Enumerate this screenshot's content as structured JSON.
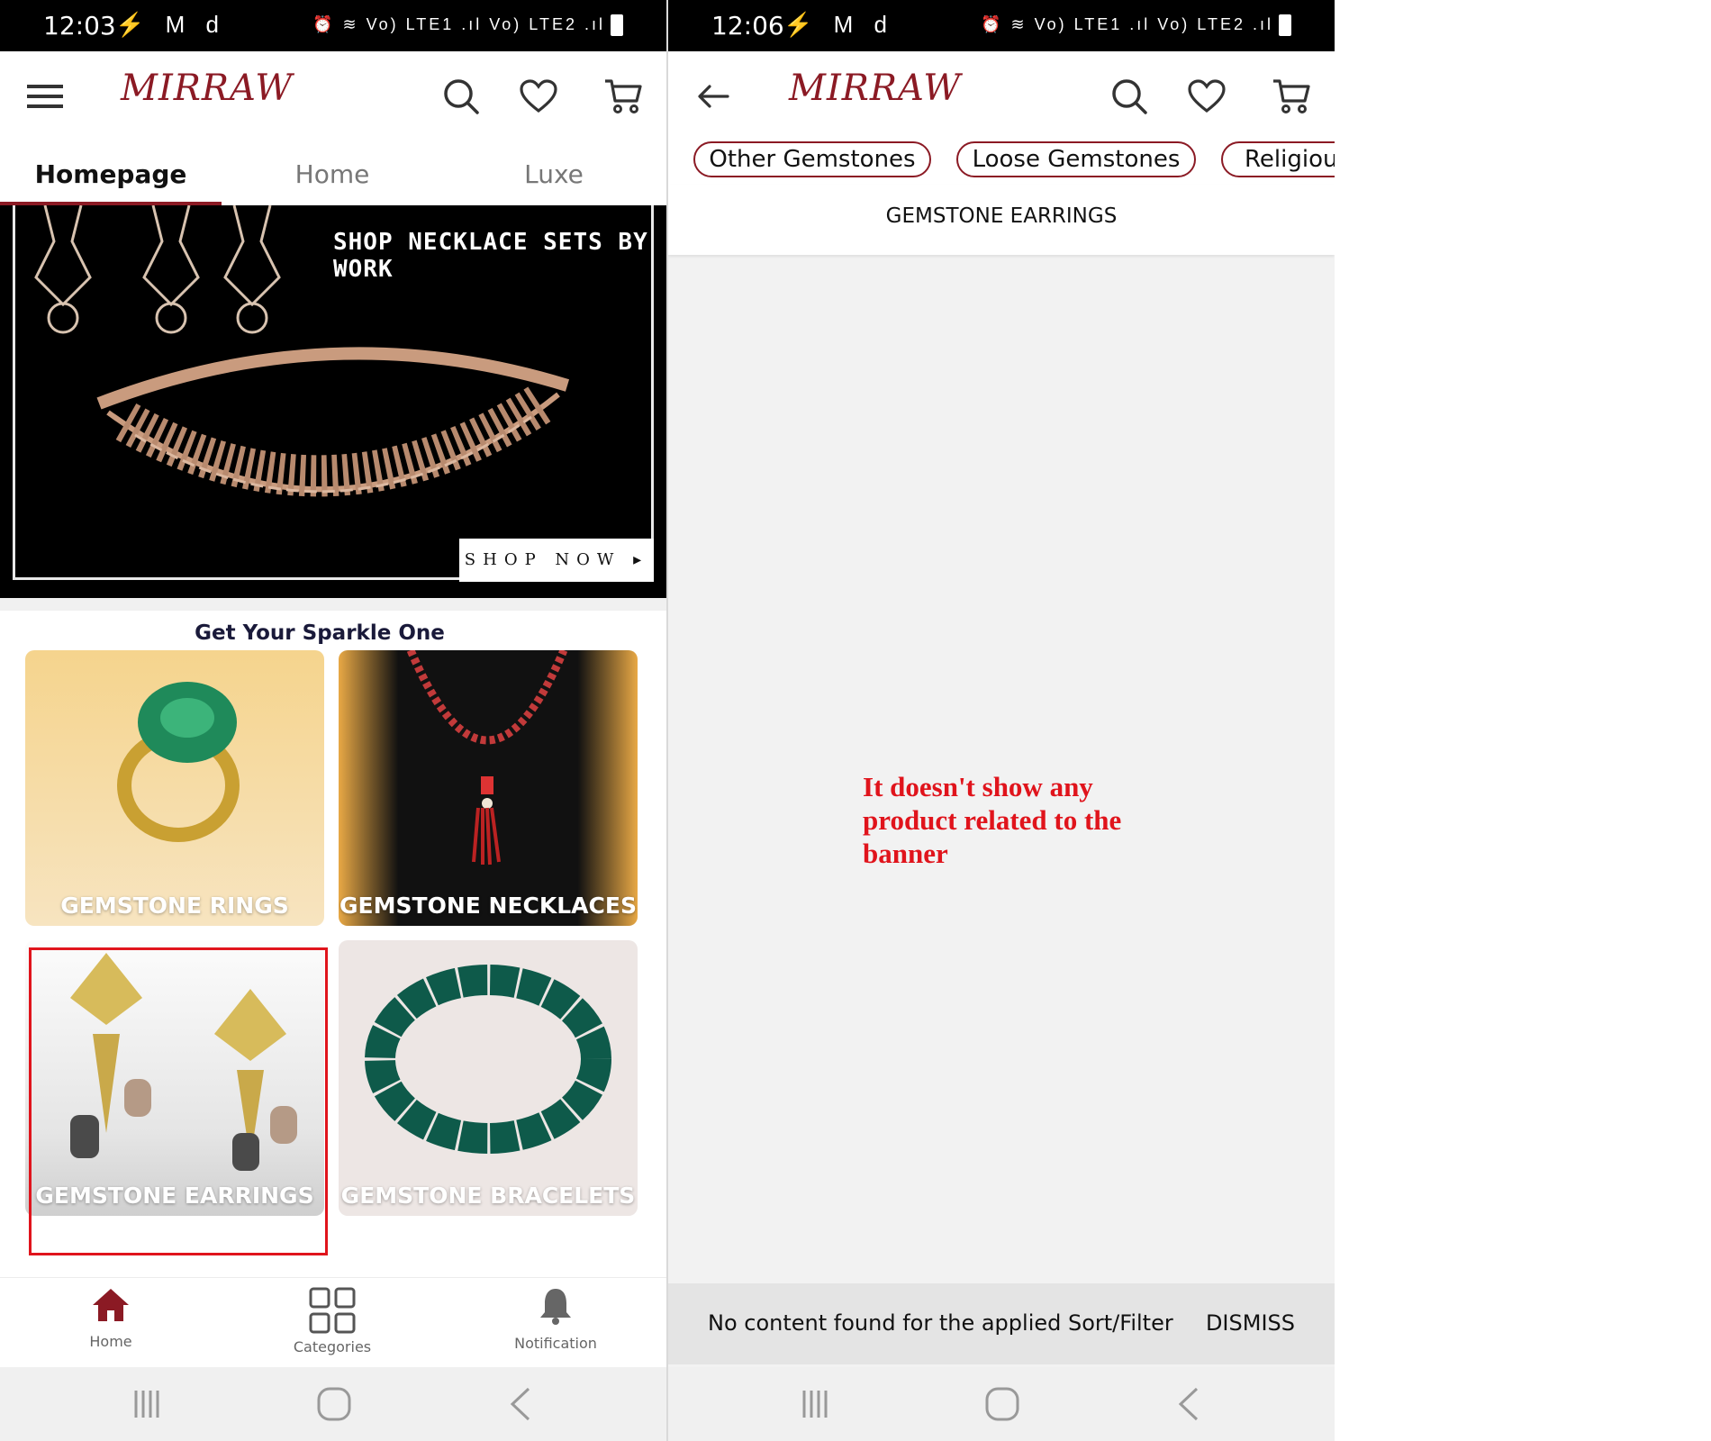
{
  "left_screen": {
    "status_bar": {
      "time": "12:03",
      "left_icons": "⚡ M d",
      "right_icons": "⏰ ≋ Vo) LTE1 .ıl Vo) LTE2 .ıl"
    },
    "app_bar": {
      "logo": "MIRRAW",
      "icons": [
        "menu-icon",
        "search-icon",
        "heart-icon",
        "cart-icon"
      ]
    },
    "tabs": [
      {
        "label": "Homepage",
        "active": true
      },
      {
        "label": "Home",
        "active": false
      },
      {
        "label": "Luxe",
        "active": false
      }
    ],
    "banner": {
      "headline": "SHOP NECKLACE SETS BY WORK",
      "cta": "SHOP NOW ▸"
    },
    "section": {
      "title": "Get Your Sparkle One",
      "tiles": [
        {
          "label": "GEMSTONE RINGS"
        },
        {
          "label": "GEMSTONE NECKLACES"
        },
        {
          "label": "GEMSTONE EARRINGS",
          "highlighted": true
        },
        {
          "label": "GEMSTONE BRACELETS"
        }
      ]
    },
    "bottom_nav": [
      {
        "label": "Home",
        "icon": "home-icon",
        "active": true
      },
      {
        "label": "Categories",
        "icon": "grid-icon",
        "active": false
      },
      {
        "label": "Notification",
        "icon": "bell-icon",
        "active": false
      }
    ]
  },
  "right_screen": {
    "status_bar": {
      "time": "12:06",
      "left_icons": "⚡ M d",
      "right_icons": "⏰ ≋ Vo) LTE1 .ıl Vo) LTE2 .ıl"
    },
    "app_bar": {
      "logo": "MIRRAW",
      "icons": [
        "back-arrow-icon",
        "search-icon",
        "heart-icon",
        "cart-icon"
      ]
    },
    "chips": [
      "Other Gemstones",
      "Loose Gemstones",
      "Religious"
    ],
    "page_title": "GEMSTONE EARRINGS",
    "annotation": "It doesn't show any product related to the banner",
    "snackbar": {
      "message": "No content found for the applied Sort/Filter",
      "action": "DISMISS"
    }
  },
  "colors": {
    "brand": "#8b1a24",
    "highlight": "#e0141c",
    "annotation": "#e0141c"
  }
}
